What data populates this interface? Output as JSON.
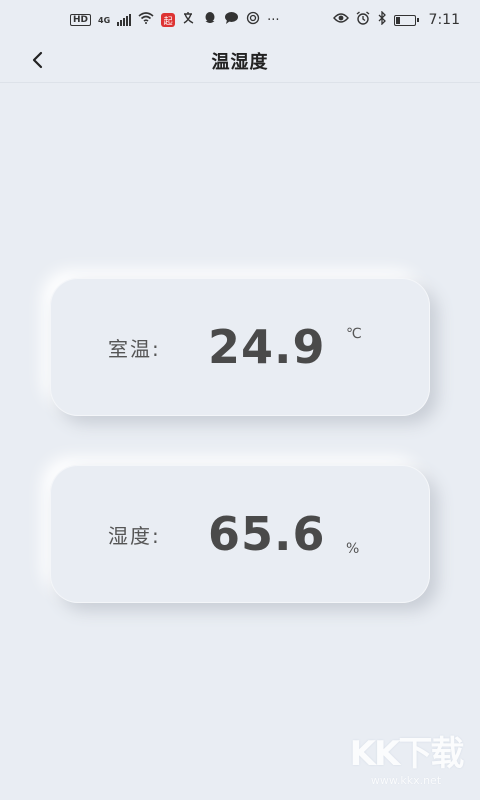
{
  "status_bar": {
    "hd": "HD",
    "network": "4G",
    "app_badge": "起",
    "more": "···",
    "time": "7:11",
    "battery_level": 0.25,
    "icons": [
      "signal-icon",
      "wifi-icon",
      "app-icon",
      "translate-icon",
      "qq-icon",
      "chat-icon",
      "hotspot-icon",
      "eye-icon",
      "alarm-icon",
      "bluetooth-icon",
      "battery-icon"
    ]
  },
  "nav": {
    "title": "温湿度",
    "back_icon": "chevron-left-icon"
  },
  "temperature": {
    "label": "室温:",
    "value": "24.9",
    "unit": "℃"
  },
  "humidity": {
    "label": "湿度:",
    "value": "65.6",
    "unit": "%"
  },
  "watermark": {
    "logo": "KK下载",
    "url": "www.kkx.net"
  }
}
